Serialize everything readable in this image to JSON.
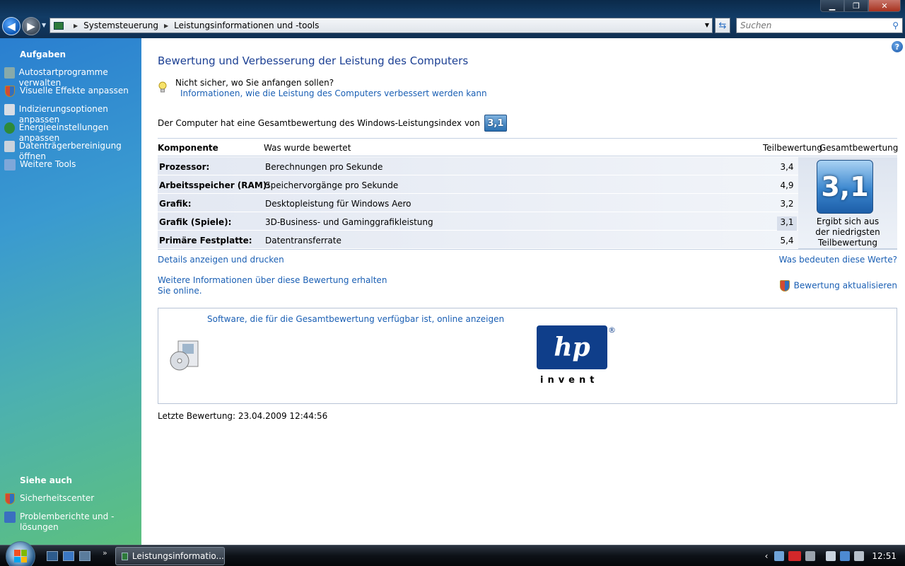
{
  "window": {
    "controls": {
      "minimize": "▁",
      "maximize": "❐",
      "close": "✕"
    }
  },
  "addressbar": {
    "crumbs": [
      "Systemsteuerung",
      "Leistungsinformationen und -tools"
    ],
    "search_placeholder": "Suchen"
  },
  "sidebar": {
    "tasks_heading": "Aufgaben",
    "tasks": [
      {
        "label": "Autostartprogramme verwalten",
        "icon": "startup-icon"
      },
      {
        "label": "Visuelle Effekte anpassen",
        "icon": "shield-icon"
      },
      {
        "label": "Indizierungsoptionen anpassen",
        "icon": "indexing-icon"
      },
      {
        "label": "Energieeinstellungen anpassen",
        "icon": "power-icon"
      },
      {
        "label": "Datenträgerbereinigung öffnen",
        "icon": "disk-cleanup-icon"
      },
      {
        "label": "Weitere Tools",
        "icon": "tools-icon"
      }
    ],
    "see_also_heading": "Siehe auch",
    "see_also": [
      {
        "label": "Sicherheitscenter",
        "icon": "security-center-icon"
      },
      {
        "label": "Problemberichte und -lösungen",
        "icon": "problem-reports-icon"
      }
    ]
  },
  "main": {
    "title": "Bewertung und Verbesserung der Leistung des Computers",
    "tip_question": "Nicht sicher, wo Sie anfangen sollen?",
    "tip_link": "Informationen, wie die Leistung des Computers verbessert werden kann",
    "overall_text": "Der Computer hat eine Gesamtbewertung des Windows-Leistungsindex von",
    "overall_score": "3,1",
    "table": {
      "headers": {
        "component": "Komponente",
        "rated": "Was wurde bewertet",
        "subscore": "Teilbewertung",
        "basescore": "Gesamtbewertung"
      },
      "rows": [
        {
          "component": "Prozessor:",
          "rated": "Berechnungen pro Sekunde",
          "subscore": "3,4"
        },
        {
          "component": "Arbeitsspeicher (RAM):",
          "rated": "Speichervorgänge pro Sekunde",
          "subscore": "4,9"
        },
        {
          "component": "Grafik:",
          "rated": "Desktopleistung für Windows Aero",
          "subscore": "3,2"
        },
        {
          "component": "Grafik (Spiele):",
          "rated": "3D-Business- und Gaminggrafikleistung",
          "subscore": "3,1"
        },
        {
          "component": "Primäre Festplatte:",
          "rated": "Datentransferrate",
          "subscore": "5,4"
        }
      ],
      "base_score": "3,1",
      "base_note_lines": [
        "Ergibt sich aus",
        "der niedrigsten",
        "Teilbewertung"
      ]
    },
    "links": {
      "details": "Details anzeigen und drucken",
      "meaning": "Was bedeuten diese Werte?",
      "more_info_1": "Weitere Informationen über diese Bewertung erhalten",
      "more_info_2": "Sie online.",
      "update": "Bewertung aktualisieren"
    },
    "software_link": "Software, die für die Gesamtbewertung verfügbar ist, online anzeigen",
    "hp": {
      "logo": "hp",
      "tagline": "invent",
      "reg": "®"
    },
    "last_rating": "Letzte Bewertung: 23.04.2009 12:44:56"
  },
  "taskbar": {
    "task_label": "Leistungsinformatio...",
    "clock": "12:51",
    "more": "»",
    "tray_expand": "‹"
  },
  "colors": {
    "link": "#1a5fb4",
    "title": "#1b3f93",
    "badge": "#2a6fb0"
  }
}
